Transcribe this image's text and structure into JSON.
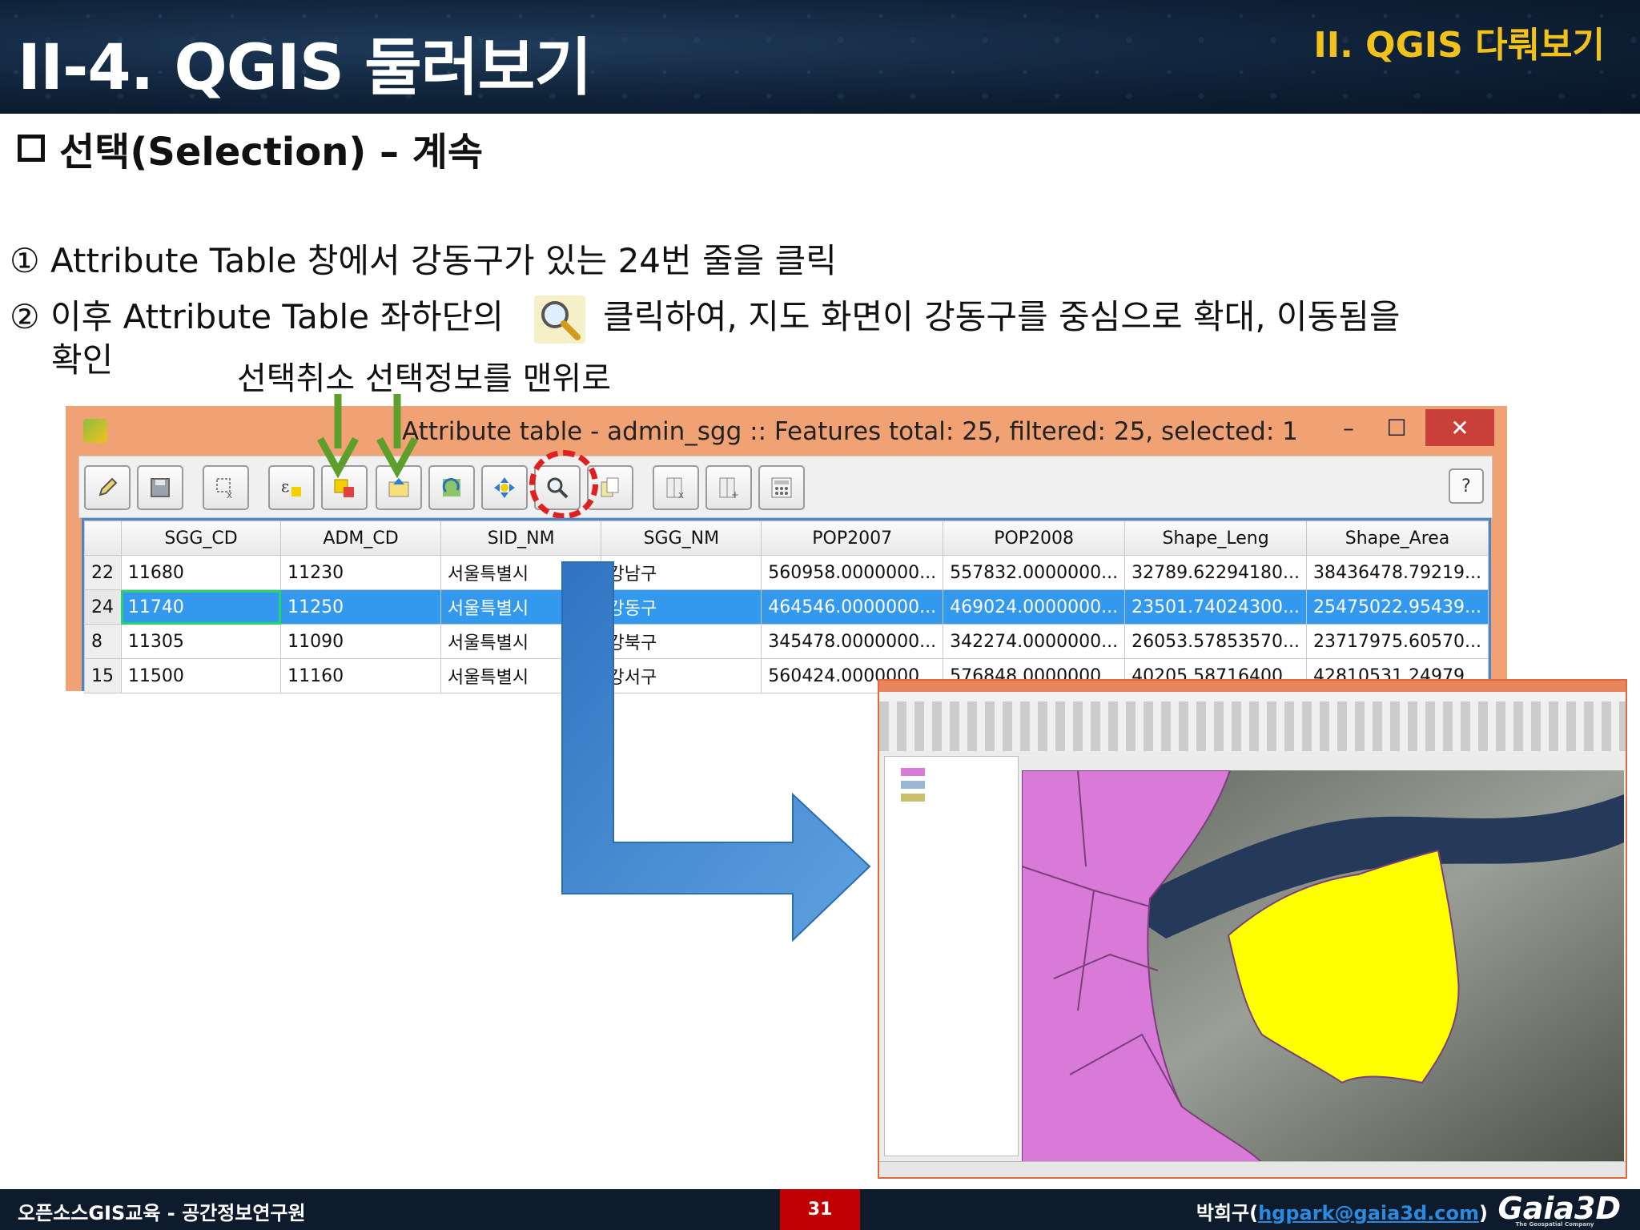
{
  "header": {
    "title": "II-4. QGIS 둘러보기",
    "section": "II. QGIS 다뤄보기"
  },
  "subheading": "선택(Selection) – 계속",
  "steps": {
    "step1": "① Attribute Table 창에서 강동구가 있는 24번 줄을 클릭",
    "step2_before": "② 이후 Attribute Table 좌하단의",
    "step2_after": "클릭하여, 지도 화면이 강동구를 중심으로 확대, 이동됨을",
    "step2_cont": "확인"
  },
  "annotation": "선택취소  선택정보를 맨위로",
  "attribute_window": {
    "title": "Attribute table - admin_sgg :: Features total: 25, filtered: 25, selected: 1",
    "minimize": "–",
    "maximize": "☐",
    "close": "✕",
    "help": "?",
    "columns": [
      "SGG_CD",
      "ADM_CD",
      "SID_NM",
      "SGG_NM",
      "POP2007",
      "POP2008",
      "Shape_Leng",
      "Shape_Area"
    ],
    "rows": [
      {
        "id": "22",
        "cells": [
          "11680",
          "11230",
          "서울특별시",
          "강남구",
          "560958.0000000...",
          "557832.0000000...",
          "32789.62294180...",
          "38436478.79219..."
        ]
      },
      {
        "id": "24",
        "cells": [
          "11740",
          "11250",
          "서울특별시",
          "강동구",
          "464546.0000000...",
          "469024.0000000...",
          "23501.74024300...",
          "25475022.95439..."
        ]
      },
      {
        "id": "8",
        "cells": [
          "11305",
          "11090",
          "서울특별시",
          "강북구",
          "345478.0000000...",
          "342274.0000000...",
          "26053.57853570...",
          "23717975.60570..."
        ]
      },
      {
        "id": "15",
        "cells": [
          "11500",
          "11160",
          "서울특별시",
          "강서구",
          "560424.0000000...",
          "576848.0000000...",
          "40205.58716400...",
          "42810531.24979..."
        ]
      }
    ]
  },
  "colors": {
    "header_bg": "#0f2238",
    "section_accent": "#f2c21b",
    "window_frame": "#f0a275",
    "selected_row": "#3399ee",
    "focus_cell": "#25d46a",
    "arrow": "#3f86cf",
    "annotation_arrow": "#5e9e2a",
    "highlight_ring": "#e02020",
    "district_fill": "#d97ad9",
    "selected_fill": "#ffff00",
    "page_badge": "#c00000"
  },
  "footer": {
    "left": "오픈소스GIS교육 - 공간정보연구원",
    "page": "31",
    "author_name": "박희구(",
    "author_email": "hgpark@gaia3d.com",
    "author_close": ")",
    "logo": "Gaia3D",
    "logo_tagline": "The Geospatial Company"
  }
}
